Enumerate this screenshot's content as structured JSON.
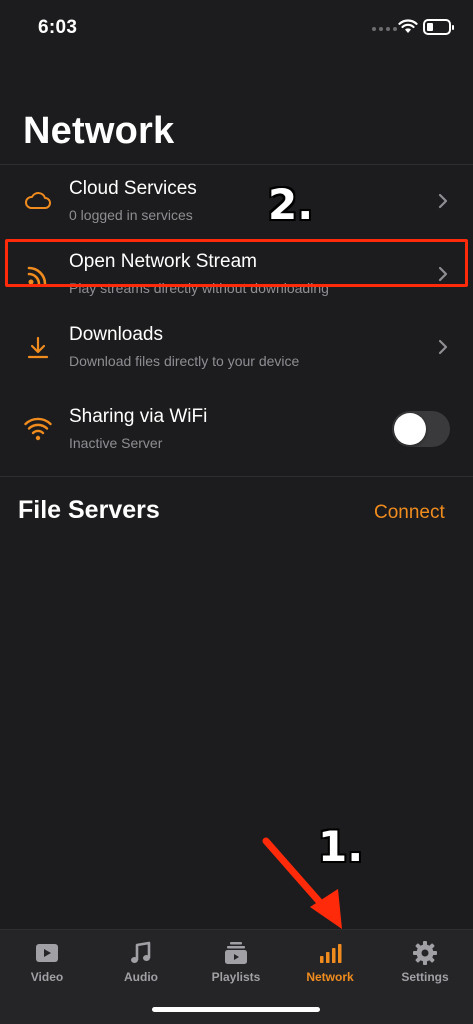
{
  "status_bar": {
    "time": "6:03"
  },
  "page": {
    "title": "Network"
  },
  "rows": [
    {
      "title": "Cloud Services",
      "subtitle": "0 logged in services",
      "icon": "cloud-icon"
    },
    {
      "title": "Open Network Stream",
      "subtitle": "Play streams directly without downloading",
      "icon": "rss-icon"
    },
    {
      "title": "Downloads",
      "subtitle": "Download files directly to your device",
      "icon": "download-icon"
    },
    {
      "title": "Sharing via WiFi",
      "subtitle": "Inactive Server",
      "icon": "wifi-icon",
      "toggle_on": false
    }
  ],
  "file_servers": {
    "title": "File Servers",
    "action": "Connect"
  },
  "annotations": {
    "step1": "1.",
    "step2": "2."
  },
  "tabs": [
    {
      "label": "Video",
      "icon": "video-icon",
      "active": false
    },
    {
      "label": "Audio",
      "icon": "music-note-icon",
      "active": false
    },
    {
      "label": "Playlists",
      "icon": "playlists-icon",
      "active": false
    },
    {
      "label": "Network",
      "icon": "network-bars-icon",
      "active": true
    },
    {
      "label": "Settings",
      "icon": "gear-icon",
      "active": false
    }
  ],
  "colors": {
    "accent": "#f08c1e",
    "background": "#1c1c1e",
    "highlight": "#ff2a0a"
  }
}
